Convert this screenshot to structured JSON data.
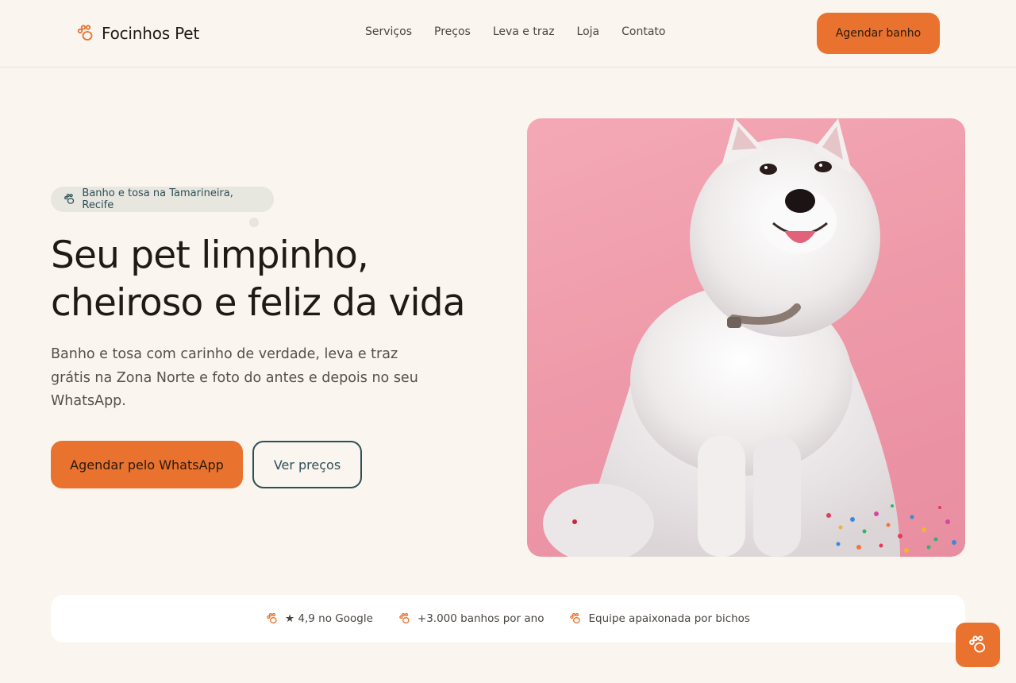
{
  "header": {
    "brand_name": "Focinhos Pet",
    "nav": [
      "Serviços",
      "Preços",
      "Leva e traz",
      "Loja",
      "Contato"
    ],
    "cta_label": "Agendar banho"
  },
  "hero": {
    "badge": "Banho e tosa na Tamarineira, Recife",
    "headline_line1": "Seu pet limpinho,",
    "headline_line2": "cheiroso e feliz da vida",
    "subtitle": "Banho e tosa com carinho de verdade, leva e traz grátis na Zona Norte e foto do antes e depois no seu WhatsApp.",
    "primary_cta": "Agendar pelo WhatsApp",
    "secondary_cta": "Ver preços"
  },
  "stats": [
    "★ 4,9 no Google",
    "+3.000 banhos por ano",
    "Equipe apaixonada por bichos"
  ],
  "colors": {
    "accent": "#e8722e",
    "teal": "#2d4f57",
    "background": "#faf5ee",
    "photo_bg": "#f0a0b0"
  },
  "icons": {
    "brand": "paw-icon",
    "badge": "paw-icon",
    "stats": "paw-icon",
    "fab": "paw-icon"
  }
}
